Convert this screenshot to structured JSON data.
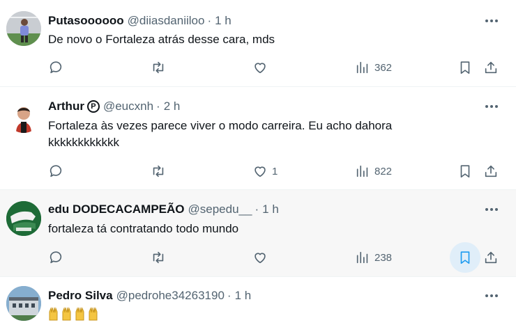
{
  "tweets": [
    {
      "name": "Putasoooooo",
      "handle": "@diiasdaniiloo",
      "time": "1 h",
      "text": "De novo  o Fortaleza atrás desse cara, mds",
      "replies": "",
      "retweets": "",
      "likes": "",
      "views": "362",
      "bookmarked": false
    },
    {
      "name": "Arthur",
      "badge": "P",
      "handle": "@eucxnh",
      "time": "2 h",
      "text": "Fortaleza às vezes parece viver o modo carreira. Eu acho dahora kkkkkkkkkkkk",
      "replies": "",
      "retweets": "",
      "likes": "1",
      "views": "822",
      "bookmarked": false
    },
    {
      "name": "edu DODECACAMPEÃO",
      "handle": "@sepedu__",
      "time": "1 h",
      "text": "fortaleza tá contratando todo mundo",
      "replies": "",
      "retweets": "",
      "likes": "",
      "views": "238",
      "bookmarked": true
    },
    {
      "name": "Pedro Silva",
      "handle": "@pedrohe34263190",
      "time": "1 h",
      "emoji": "raising-hands-emoji",
      "emoji_count": 4
    }
  ],
  "separator": "·",
  "colors": {
    "text": "#0f1419",
    "secondary": "#536471",
    "accent": "#1d9bf0",
    "hover_bg": "#f7f7f7",
    "divider": "#eff3f4"
  },
  "icons": [
    "reply-icon",
    "retweet-icon",
    "like-icon",
    "views-icon",
    "bookmark-icon",
    "share-icon",
    "more-icon"
  ]
}
